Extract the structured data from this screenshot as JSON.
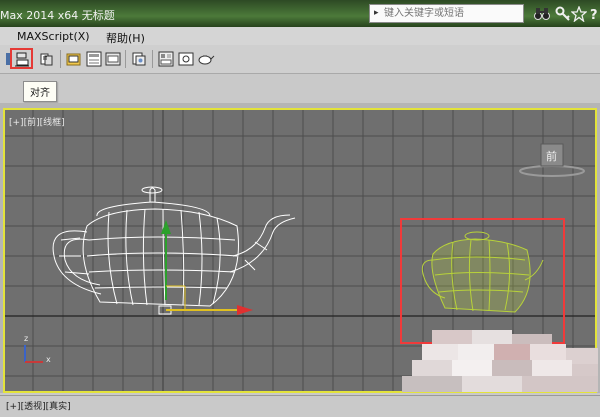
{
  "window": {
    "title": "Max  2014 x64      无标题"
  },
  "search": {
    "placeholder": "键入关键字或短语"
  },
  "menu": {
    "items": [
      "MAXScript(X)",
      "帮助(H)"
    ]
  },
  "tooltip": {
    "text": "对齐"
  },
  "viewport_top": {
    "label": "[+][前][线框]",
    "viewcube_label": "前"
  },
  "viewport_bottom": {
    "label": "[+][透视][真实]"
  },
  "axis_tripod": {
    "z": "z",
    "x": "x"
  },
  "colors": {
    "viewport_border": "#e3e33a",
    "highlight": "#e53935",
    "teapot_selected": "#b8d23a",
    "teapot_wire": "#ffffff"
  },
  "icons": [
    "binoculars-icon",
    "key-icon",
    "star-icon",
    "help-icon",
    "align-icon",
    "mirror-icon",
    "named-selection-icon",
    "layer-manager-icon",
    "curve-editor-icon",
    "schematic-view-icon",
    "material-editor-icon",
    "render-setup-icon",
    "rendered-frame-icon",
    "render-teapot-icon"
  ]
}
